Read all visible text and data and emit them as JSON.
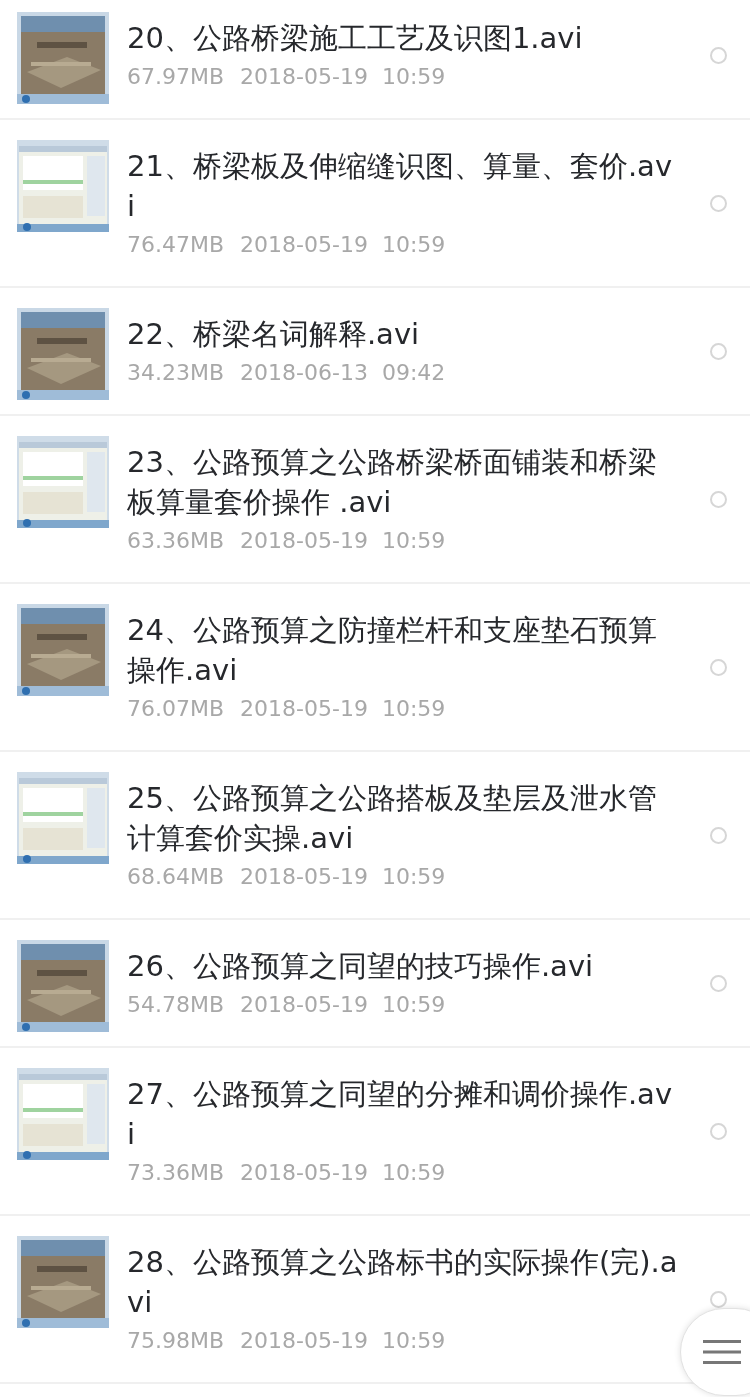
{
  "files": [
    {
      "title": "20、公路桥梁施工工艺及识图1.avi",
      "size": "67.97MB",
      "date": "2018-05-19  10:59",
      "selected": false
    },
    {
      "title": "21、桥梁板及伸缩缝识图、算量、套价.avi",
      "size": "76.47MB",
      "date": "2018-05-19  10:59",
      "selected": false
    },
    {
      "title": "22、桥梁名词解释.avi",
      "size": "34.23MB",
      "date": "2018-06-13  09:42",
      "selected": false
    },
    {
      "title": "23、公路预算之公路桥梁桥面铺装和桥梁板算量套价操作 .avi",
      "size": "63.36MB",
      "date": "2018-05-19  10:59",
      "selected": false
    },
    {
      "title": "24、公路预算之防撞栏杆和支座垫石预算操作.avi",
      "size": "76.07MB",
      "date": "2018-05-19  10:59",
      "selected": false
    },
    {
      "title": "25、公路预算之公路搭板及垫层及泄水管计算套价实操.avi",
      "size": "68.64MB",
      "date": "2018-05-19  10:59",
      "selected": false
    },
    {
      "title": "26、公路预算之同望的技巧操作.avi",
      "size": "54.78MB",
      "date": "2018-05-19  10:59",
      "selected": false
    },
    {
      "title": "27、公路预算之同望的分摊和调价操作.avi",
      "size": "73.36MB",
      "date": "2018-05-19  10:59",
      "selected": false
    },
    {
      "title": "28、公路预算之公路标书的实际操作(完).avi",
      "size": "75.98MB",
      "date": "2018-05-19  10:59",
      "selected": false
    }
  ]
}
